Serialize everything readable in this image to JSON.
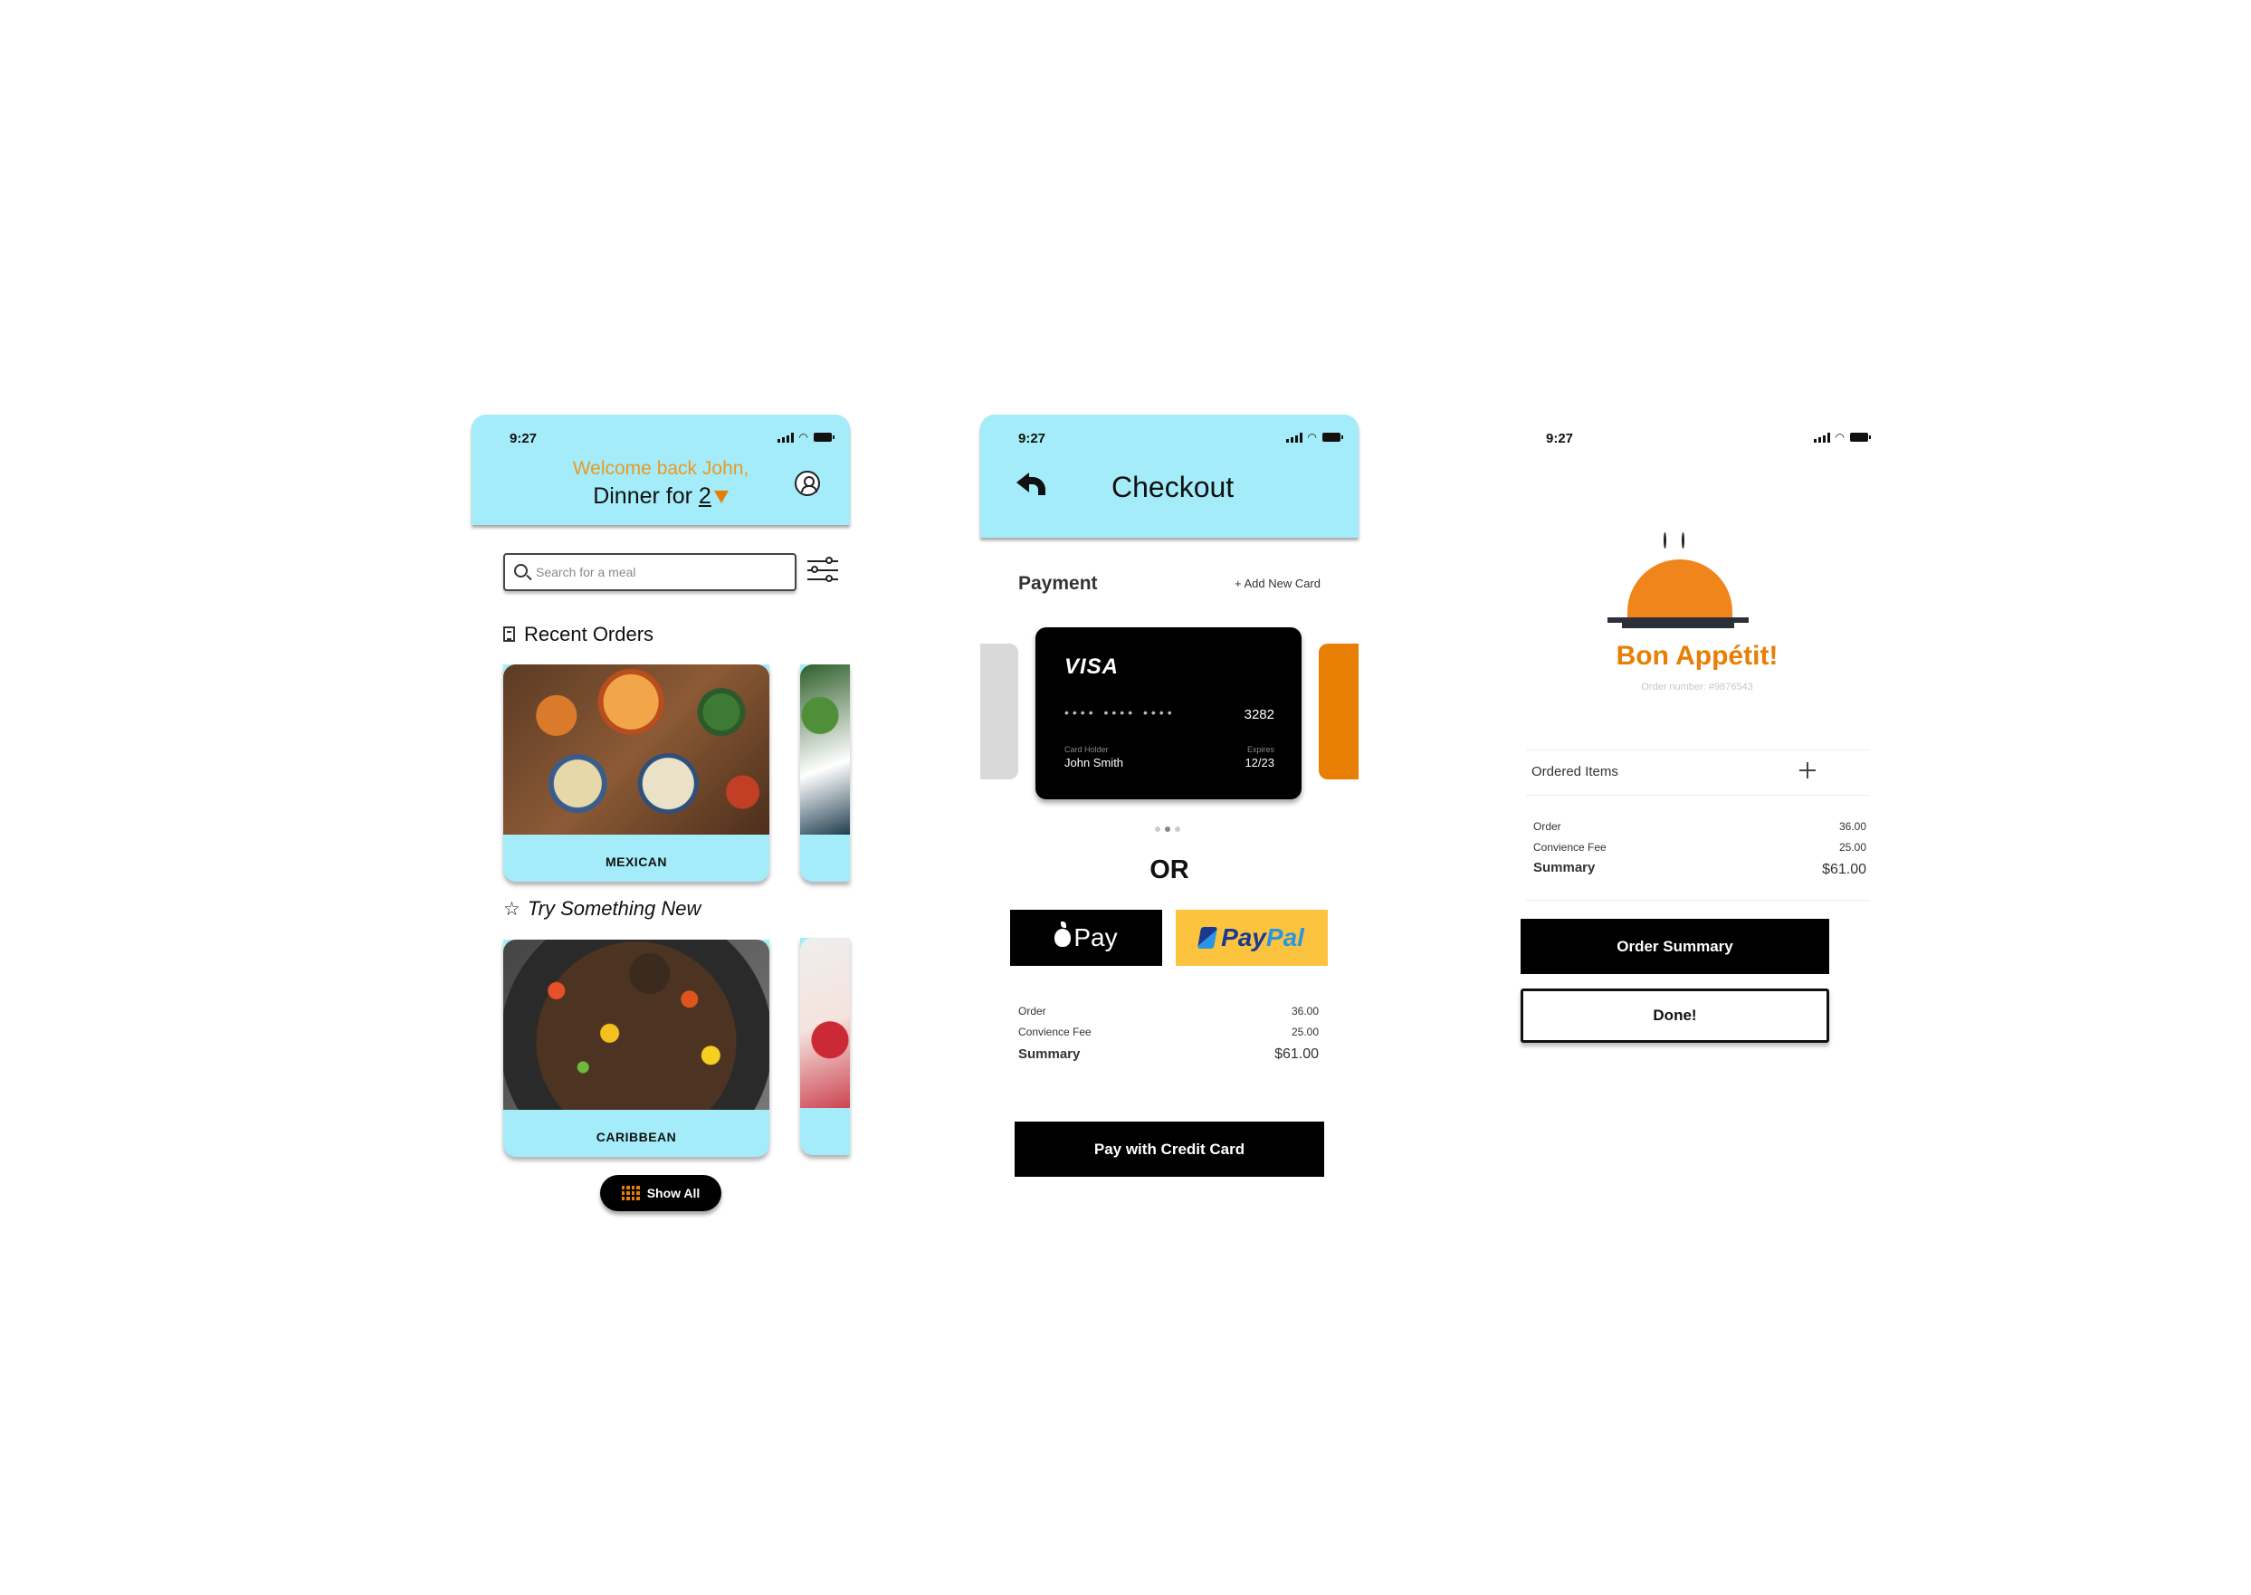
{
  "home": {
    "status_time": "9:27",
    "welcome": "Welcome back John,",
    "dinner_prefix": "Dinner for",
    "dinner_count": "2",
    "search_placeholder": "Search for a meal",
    "recent_orders_title": "Recent Orders",
    "recent_orders": [
      {
        "label": "MEXICAN"
      }
    ],
    "try_new_title": "Try Something New",
    "try_new": [
      {
        "label": "CARIBBEAN"
      }
    ],
    "show_all_label": "Show All",
    "colors": {
      "header": "#a4ecf9",
      "accent": "#e87e04",
      "welcome": "#e99a22"
    }
  },
  "checkout": {
    "status_time": "9:27",
    "title": "Checkout",
    "payment_label": "Payment",
    "add_card_label": "+ Add New Card",
    "card": {
      "brand": "VISA",
      "masked": "•••• •••• ••••",
      "last4": "3282",
      "holder_label": "Card Holder",
      "holder": "John Smith",
      "expires_label": "Expires",
      "expires": "12/23"
    },
    "or_label": "OR",
    "apple_pay_label": "Pay",
    "paypal_label_1": "Pay",
    "paypal_label_2": "Pal",
    "summary": {
      "order_label": "Order",
      "order_value": "36.00",
      "fee_label": "Convience Fee",
      "fee_value": "25.00",
      "total_label": "Summary",
      "total_value": "$61.00"
    },
    "pay_button_label": "Pay with Credit Card"
  },
  "confirm": {
    "status_time": "9:27",
    "heading": "Bon Appétit!",
    "order_number": "Order number: #9876543",
    "ordered_items_label": "Ordered Items",
    "summary": {
      "order_label": "Order",
      "order_value": "36.00",
      "fee_label": "Convience Fee",
      "fee_value": "25.00",
      "total_label": "Summary",
      "total_value": "$61.00"
    },
    "order_summary_button": "Order Summary",
    "done_button": "Done!"
  }
}
